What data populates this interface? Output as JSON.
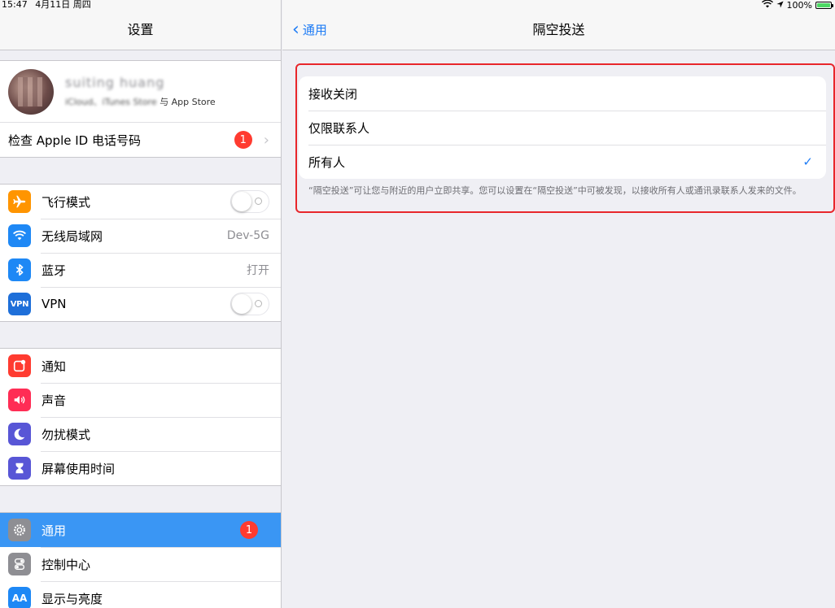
{
  "status": {
    "time": "15:47",
    "date": "4月11日 周四",
    "battery": "100%",
    "battery_level": 1.0
  },
  "sidebar": {
    "title": "设置",
    "profile": {
      "name": "suiting huang",
      "sub_blur": "iCloud、iTunes Store",
      "sub": "与 App Store"
    },
    "apple_id_row": {
      "label": "检查 Apple ID 电话号码",
      "badge": "1"
    },
    "group1": [
      {
        "label": "飞行模式",
        "icon": "airplane-icon",
        "toggle": false
      },
      {
        "label": "无线局域网",
        "icon": "wifi-icon",
        "value": "Dev-5G"
      },
      {
        "label": "蓝牙",
        "icon": "bluetooth-icon",
        "value": "打开"
      },
      {
        "label": "VPN",
        "icon": "vpn-icon",
        "icon_text": "VPN",
        "toggle": false
      }
    ],
    "group2": [
      {
        "label": "通知",
        "icon": "notifications-icon"
      },
      {
        "label": "声音",
        "icon": "sound-icon"
      },
      {
        "label": "勿扰模式",
        "icon": "moon-icon"
      },
      {
        "label": "屏幕使用时间",
        "icon": "hourglass-icon"
      }
    ],
    "group3": [
      {
        "label": "通用",
        "icon": "gear-icon",
        "badge": "1",
        "selected": true
      },
      {
        "label": "控制中心",
        "icon": "toggles-icon"
      },
      {
        "label": "显示与亮度",
        "icon": "display-icon",
        "icon_text": "AA"
      }
    ]
  },
  "main": {
    "back_label": "通用",
    "title": "隔空投送",
    "options": [
      {
        "label": "接收关闭",
        "checked": false
      },
      {
        "label": "仅限联系人",
        "checked": false
      },
      {
        "label": "所有人",
        "checked": true
      }
    ],
    "check_glyph": "✓",
    "footnote": "“隔空投送”可让您与附近的用户立即共享。您可以设置在“隔空投送”中可被发现，以接收所有人或通讯录联系人发来的文件。"
  },
  "colors": {
    "accent": "#1e7cf5",
    "selected_row": "#3a96f4",
    "highlight_border": "#e8262b",
    "badge": "#ff3b30"
  }
}
